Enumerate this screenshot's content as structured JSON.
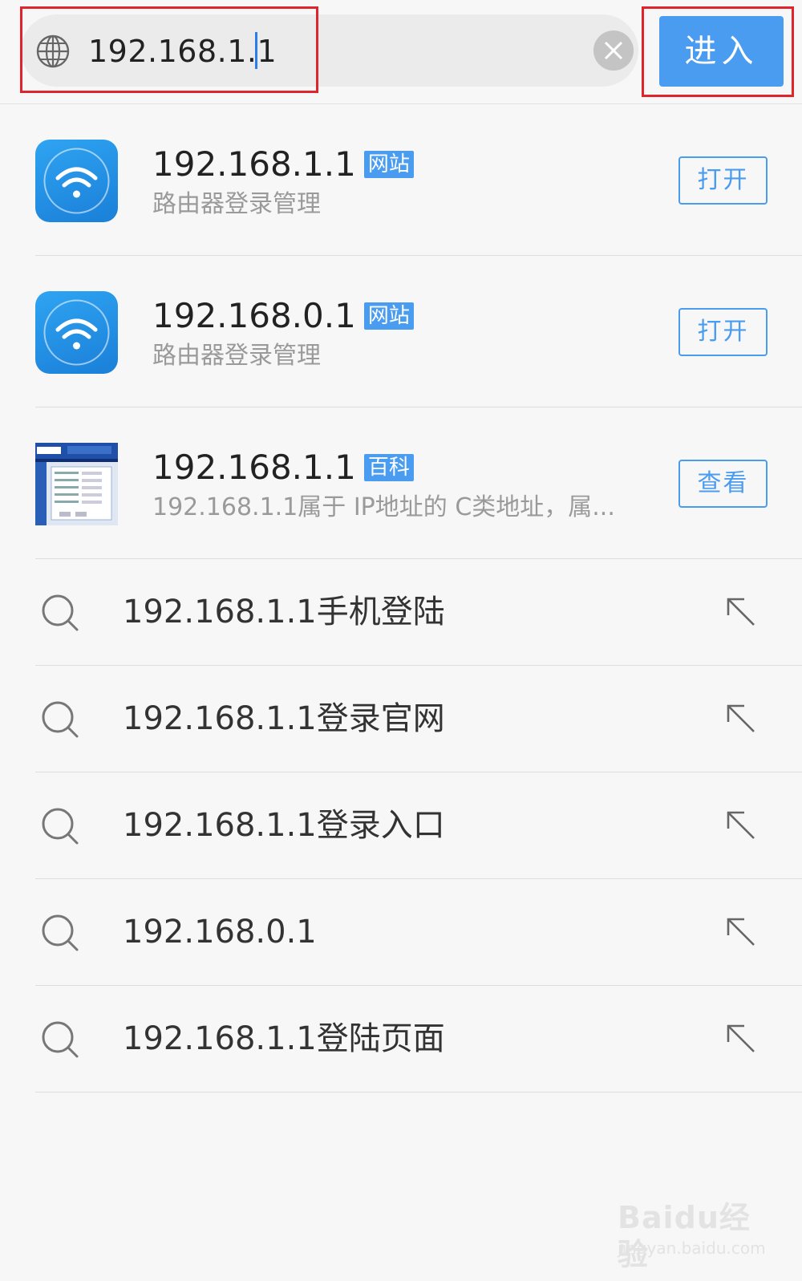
{
  "search": {
    "url_value": "192.168.1.1",
    "enter_label": "进入"
  },
  "results": [
    {
      "title": "192.168.1.1",
      "badge": "网站",
      "subtitle": "路由器登录管理",
      "action": "打开",
      "icon": "wifi-icon"
    },
    {
      "title": "192.168.0.1",
      "badge": "网站",
      "subtitle": "路由器登录管理",
      "action": "打开",
      "icon": "wifi-icon"
    },
    {
      "title": "192.168.1.1",
      "badge": "百科",
      "subtitle": "192.168.1.1属于 IP地址的 C类地址，属...",
      "action": "查看",
      "icon": "router-screenshot-thumbnail"
    }
  ],
  "suggestions": [
    "192.168.1.1手机登陆",
    "192.168.1.1登录官网",
    "192.168.1.1登录入口",
    "192.168.0.1",
    "192.168.1.1登陆页面"
  ],
  "watermark": {
    "logo": "Baidu经验",
    "url": "jingyan.baidu.com"
  },
  "colors": {
    "accent": "#4a9cf0",
    "highlight": "#e0242b",
    "background": "#f7f7f7"
  }
}
